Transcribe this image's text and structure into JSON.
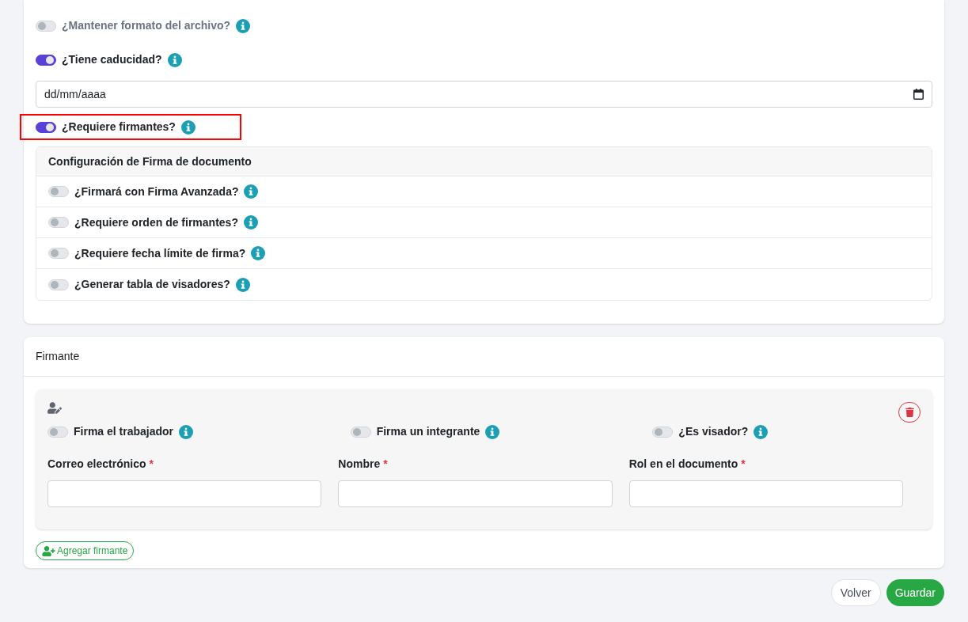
{
  "options": [
    {
      "label": "¿Mantener formato del archivo?",
      "on": false,
      "highlighted": false
    },
    {
      "label": "¿Tiene caducidad?",
      "on": true,
      "highlighted": false
    }
  ],
  "expiry_date": {
    "placeholder": "dd/mm/aaaa"
  },
  "signers_option": {
    "label": "¿Requiere firmantes?",
    "on": true,
    "highlighted": true
  },
  "signature_config": {
    "title": "Configuración de Firma de documento",
    "options": [
      {
        "label": "¿Firmará con Firma Avanzada?",
        "on": false
      },
      {
        "label": "¿Requiere orden de firmantes?",
        "on": false
      },
      {
        "label": "¿Requiere fecha límite de firma?",
        "on": false
      },
      {
        "label": "¿Generar tabla de visadores?",
        "on": false
      }
    ]
  },
  "signer_section": {
    "title": "Firmante",
    "signer": {
      "options": [
        {
          "label": "Firma el trabajador",
          "on": false
        },
        {
          "label": "Firma un integrante",
          "on": false
        },
        {
          "label": "¿Es visador?",
          "on": false
        }
      ],
      "fields": [
        {
          "label": "Correo electrónico",
          "required_mark": "*"
        },
        {
          "label": "Nombre",
          "required_mark": "*"
        },
        {
          "label": "Rol en el documento",
          "required_mark": "*"
        }
      ]
    },
    "add_button": "Agregar firmante"
  },
  "buttons": [
    {
      "label": "Volver",
      "kind": "secondary"
    },
    {
      "label": "Guardar",
      "kind": "primary"
    }
  ]
}
